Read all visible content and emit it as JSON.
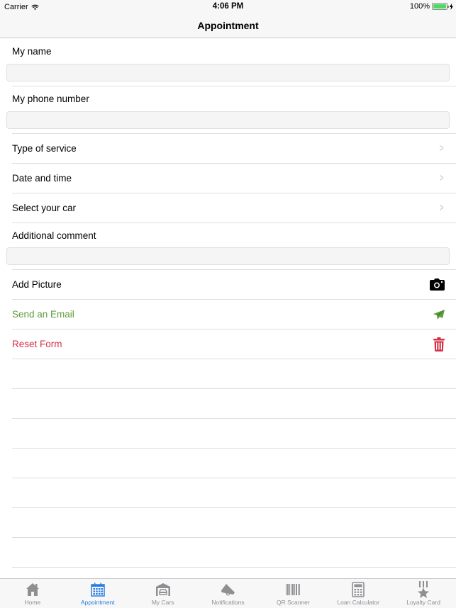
{
  "status_bar": {
    "carrier": "Carrier",
    "time": "4:06 PM",
    "battery": "100%",
    "battery_level": 1.0
  },
  "nav": {
    "title": "Appointment"
  },
  "form": {
    "name_label": "My name",
    "name_value": "",
    "phone_label": "My phone number",
    "phone_value": "",
    "type_of_service": "Type of service",
    "date_and_time": "Date and time",
    "select_car": "Select your car",
    "comment_label": "Additional comment",
    "comment_value": "",
    "add_picture": "Add Picture",
    "send_email": "Send an Email",
    "reset_form": "Reset Form"
  },
  "colors": {
    "accent": "#2a7de1",
    "send": "#5c9d3b",
    "reset": "#d42f43"
  },
  "tabs": [
    {
      "label": "Home",
      "icon": "home-icon"
    },
    {
      "label": "Appointment",
      "icon": "calendar-icon",
      "active": true
    },
    {
      "label": "My Cars",
      "icon": "garage-icon"
    },
    {
      "label": "Notifications",
      "icon": "megaphone-icon"
    },
    {
      "label": "QR Scanner",
      "icon": "barcode-icon"
    },
    {
      "label": "Loan Calculator",
      "icon": "calculator-icon"
    },
    {
      "label": "Loyalty Card",
      "icon": "medal-icon"
    }
  ]
}
